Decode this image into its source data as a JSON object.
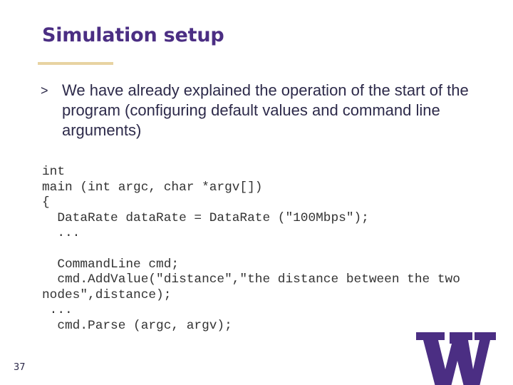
{
  "slide": {
    "title": "Simulation setup",
    "bullet": {
      "marker": ">",
      "text": "We have already explained the operation of the start of the program (configuring default values and command line arguments)"
    },
    "code_lines": [
      "int",
      "main (int argc, char *argv[])",
      "{",
      "  DataRate dataRate = DataRate (\"100Mbps\");",
      "  ...",
      "",
      "  CommandLine cmd;",
      "  cmd.AddValue(\"distance\",\"the distance between the two",
      "nodes\",distance);",
      " ...",
      "  cmd.Parse (argc, argv);"
    ],
    "slide_number": "37",
    "logo": {
      "icon": "university-w-logo-icon",
      "color": "#4b2e83"
    },
    "accent_colors": {
      "title": "#4b2e83",
      "underline": "#e8d3a2"
    }
  }
}
